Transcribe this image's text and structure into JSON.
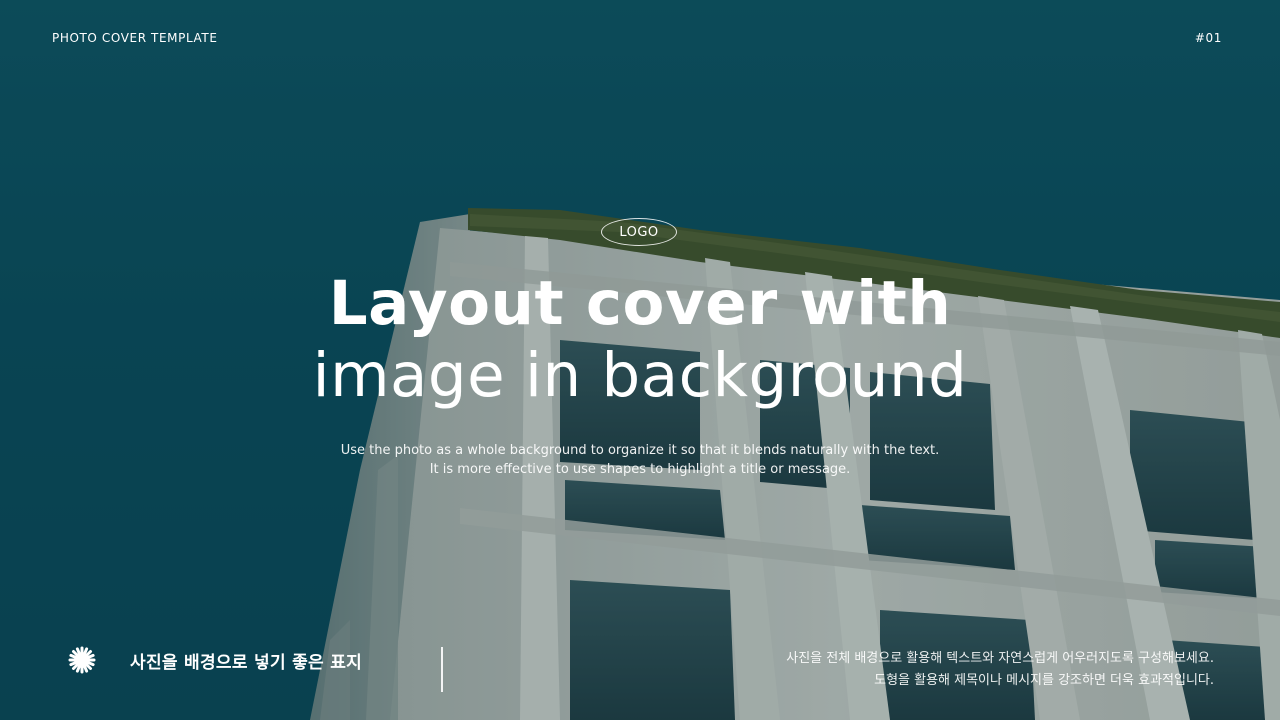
{
  "header": {
    "left_label": "PHOTO COVER TEMPLATE",
    "right_label": "#01"
  },
  "logo": {
    "text": "LOGO"
  },
  "title": {
    "line1": "Layout cover with",
    "line2": "image in background"
  },
  "subtitle": {
    "line1": "Use the photo as a whole background to organize it so that it blends naturally with the text.",
    "line2": "It is more effective to use shapes to highlight a title or message."
  },
  "footer": {
    "icon": "asterisk-star-icon",
    "label": "사진을 배경으로 넣기 좋은 표지",
    "description_line1": "사진을 전체 배경으로 활용해 텍스트와 자연스럽게 어우러지도록 구성해보세요.",
    "description_line2": "도형을 활용해 제목이나 메시지를 강조하면 더욱 효과적입니다."
  },
  "colors": {
    "sky": "#0c4f5f",
    "building": "#d6d4cb",
    "window": "#2f4a4e",
    "foliage": "#4e5a2c",
    "text": "#ffffff"
  }
}
